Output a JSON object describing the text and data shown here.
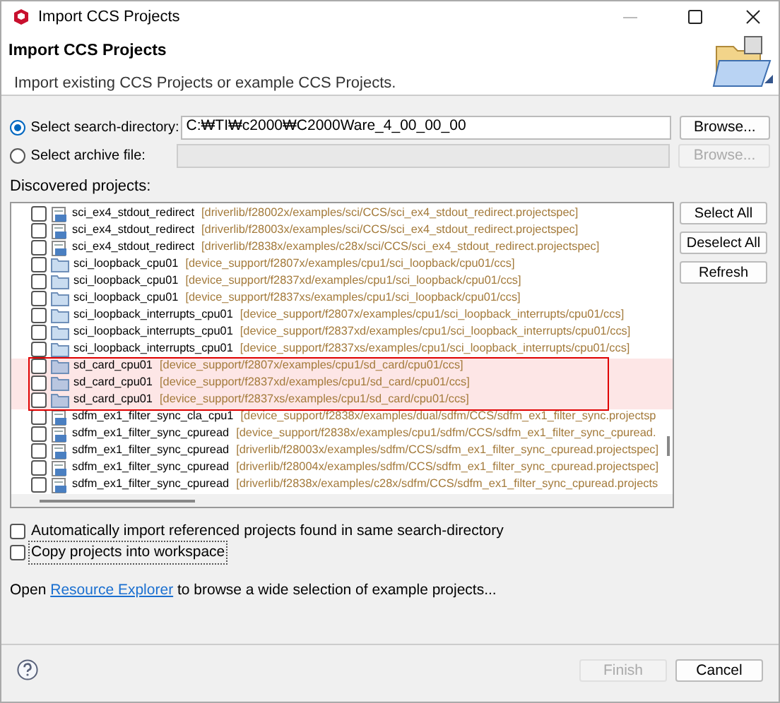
{
  "window": {
    "title": "Import CCS Projects"
  },
  "header": {
    "title": "Import CCS Projects",
    "description": "Import existing CCS Projects or example CCS Projects."
  },
  "sources": [
    {
      "label": "Select search-directory:",
      "selected": true,
      "value": "C:₩TI₩c2000₩C2000Ware_4_00_00_00",
      "button": "Browse...",
      "disabled": false
    },
    {
      "label": "Select archive file:",
      "selected": false,
      "button": "Browse...",
      "disabled": true
    }
  ],
  "projects_label": "Discovered projects:",
  "projects": [
    {
      "name": "sci_ex4_stdout_redirect",
      "path": "[driverlib/f28002x/examples/sci/CCS/sci_ex4_stdout_redirect.projectspec]",
      "kind": "spec",
      "checked": false,
      "highlighted": false
    },
    {
      "name": "sci_ex4_stdout_redirect",
      "path": "[driverlib/f28003x/examples/sci/CCS/sci_ex4_stdout_redirect.projectspec]",
      "kind": "spec",
      "checked": false,
      "highlighted": false
    },
    {
      "name": "sci_ex4_stdout_redirect",
      "path": "[driverlib/f2838x/examples/c28x/sci/CCS/sci_ex4_stdout_redirect.projectspec]",
      "kind": "spec",
      "checked": false,
      "highlighted": false
    },
    {
      "name": "sci_loopback_cpu01",
      "path": "[device_support/f2807x/examples/cpu1/sci_loopback/cpu01/ccs]",
      "kind": "folder",
      "checked": false,
      "highlighted": false
    },
    {
      "name": "sci_loopback_cpu01",
      "path": "[device_support/f2837xd/examples/cpu1/sci_loopback/cpu01/ccs]",
      "kind": "folder",
      "checked": false,
      "highlighted": false
    },
    {
      "name": "sci_loopback_cpu01",
      "path": "[device_support/f2837xs/examples/cpu1/sci_loopback/cpu01/ccs]",
      "kind": "folder",
      "checked": false,
      "highlighted": false
    },
    {
      "name": "sci_loopback_interrupts_cpu01",
      "path": "[device_support/f2807x/examples/cpu1/sci_loopback_interrupts/cpu01/ccs]",
      "kind": "folder",
      "checked": false,
      "highlighted": false
    },
    {
      "name": "sci_loopback_interrupts_cpu01",
      "path": "[device_support/f2837xd/examples/cpu1/sci_loopback_interrupts/cpu01/ccs]",
      "kind": "folder",
      "checked": false,
      "highlighted": false
    },
    {
      "name": "sci_loopback_interrupts_cpu01",
      "path": "[device_support/f2837xs/examples/cpu1/sci_loopback_interrupts/cpu01/ccs]",
      "kind": "folder",
      "checked": false,
      "highlighted": false
    },
    {
      "name": "sd_card_cpu01",
      "path": "[device_support/f2807x/examples/cpu1/sd_card/cpu01/ccs]",
      "kind": "folder",
      "checked": false,
      "highlighted": true
    },
    {
      "name": "sd_card_cpu01",
      "path": "[device_support/f2837xd/examples/cpu1/sd_card/cpu01/ccs]",
      "kind": "folder",
      "checked": false,
      "highlighted": true
    },
    {
      "name": "sd_card_cpu01",
      "path": "[device_support/f2837xs/examples/cpu1/sd_card/cpu01/ccs]",
      "kind": "folder",
      "checked": false,
      "highlighted": true
    },
    {
      "name": "sdfm_ex1_filter_sync_cla_cpu1",
      "path": "[device_support/f2838x/examples/dual/sdfm/CCS/sdfm_ex1_filter_sync.projectsp",
      "kind": "spec",
      "checked": false,
      "highlighted": false
    },
    {
      "name": "sdfm_ex1_filter_sync_cpuread",
      "path": "[device_support/f2838x/examples/cpu1/sdfm/CCS/sdfm_ex1_filter_sync_cpuread.",
      "kind": "spec",
      "checked": false,
      "highlighted": false
    },
    {
      "name": "sdfm_ex1_filter_sync_cpuread",
      "path": "[driverlib/f28003x/examples/sdfm/CCS/sdfm_ex1_filter_sync_cpuread.projectspec]",
      "kind": "spec",
      "checked": false,
      "highlighted": false
    },
    {
      "name": "sdfm_ex1_filter_sync_cpuread",
      "path": "[driverlib/f28004x/examples/sdfm/CCS/sdfm_ex1_filter_sync_cpuread.projectspec]",
      "kind": "spec",
      "checked": false,
      "highlighted": false
    },
    {
      "name": "sdfm_ex1_filter_sync_cpuread",
      "path": "[driverlib/f2838x/examples/c28x/sdfm/CCS/sdfm_ex1_filter_sync_cpuread.projects",
      "kind": "spec",
      "checked": false,
      "highlighted": false
    }
  ],
  "list_buttons": [
    "Select All",
    "Deselect All",
    "Refresh"
  ],
  "options": [
    {
      "label": "Automatically import referenced projects found in same search-directory",
      "checked": false,
      "focused": false
    },
    {
      "label": "Copy projects into workspace",
      "checked": false,
      "focused": true
    }
  ],
  "hint": {
    "before": "Open",
    "link": "Resource Explorer",
    "after": "to browse a wide selection of example projects..."
  },
  "footer_buttons": [
    {
      "label": "Finish",
      "disabled": true
    },
    {
      "label": "Cancel",
      "disabled": false
    }
  ]
}
